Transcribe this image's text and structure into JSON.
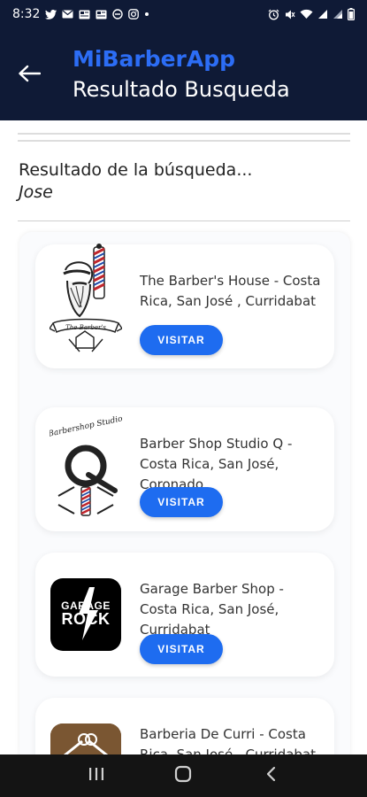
{
  "status_bar": {
    "time": "8:32",
    "left_icons": [
      "twitter-icon",
      "mail-icon",
      "news-icon",
      "news-icon",
      "minus-circle-icon",
      "instagram-icon",
      "dot-icon"
    ],
    "right_icons": [
      "alarm-icon",
      "mute-icon",
      "wifi-icon",
      "signal-icon",
      "signal-icon",
      "battery-icon"
    ]
  },
  "app_bar": {
    "title": "MiBarberApp",
    "subtitle": "Resultado Busqueda",
    "back_icon": "arrow-left-icon"
  },
  "search": {
    "heading": "Resultado de la búsqueda...",
    "query": "Jose"
  },
  "results": [
    {
      "name": "The Barber's House - Costa Rica, San José , Curridabat",
      "button": "VISITAR",
      "logo": "barber-pole-bearded-man-logo"
    },
    {
      "name": "Barber Shop Studio Q - Costa Rica, San José, Coronado",
      "button": "VISITAR",
      "logo": "barber-studio-q-logo"
    },
    {
      "name": "Garage Barber Shop - Costa Rica, San José, Curridabat",
      "button": "VISITAR",
      "logo": "garage-rock-logo",
      "logo_text": [
        "GARAGE",
        "ROCK"
      ]
    },
    {
      "name": "Barberia De Curri - Costa Rica, San José , Curridabat",
      "button": "VISITAR",
      "logo": "barberia-scissors-logo"
    }
  ],
  "nav_bar": {
    "icons": [
      "recent-apps-icon",
      "home-icon",
      "back-icon"
    ]
  },
  "colors": {
    "header_bg": "#0f1a36",
    "accent": "#2c6df5",
    "button": "#1e6cf0",
    "nav_bg": "#141414"
  }
}
